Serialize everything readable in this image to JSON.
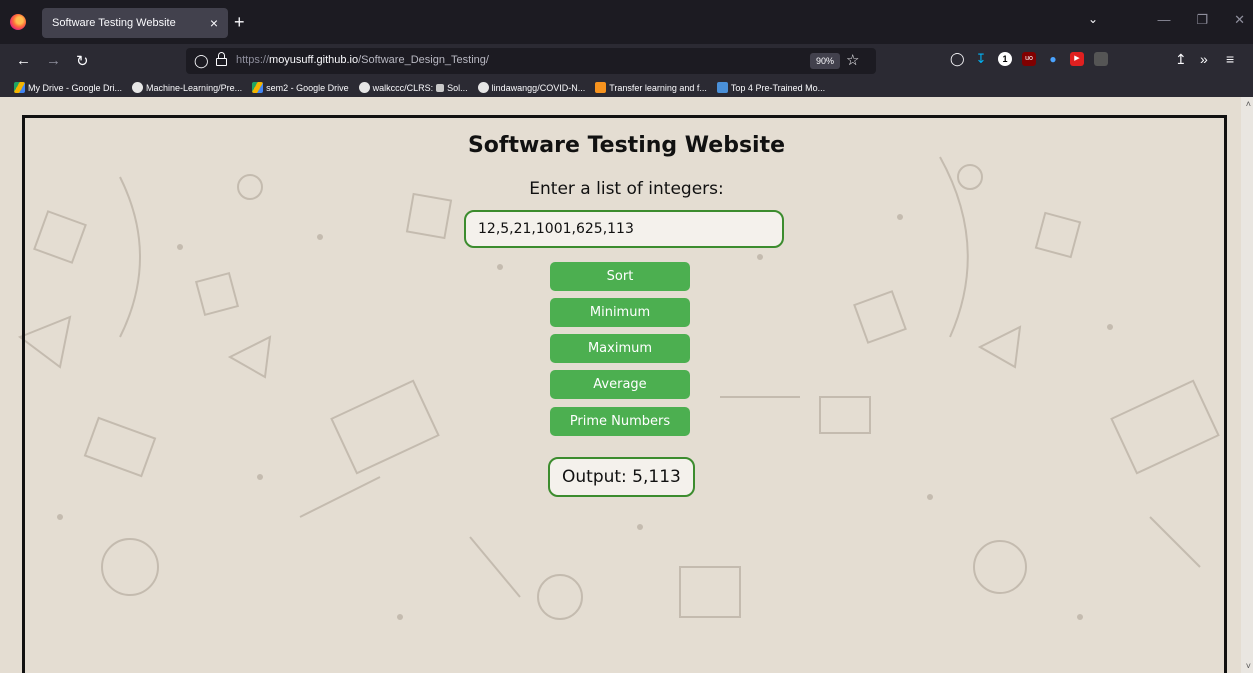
{
  "browser": {
    "tab_title": "Software Testing Website",
    "tab_close": "×",
    "new_tab": "+",
    "url_protocol": "https://",
    "url_host": "moyusuff.github.io",
    "url_path": "/Software_Design_Testing/",
    "zoom": "90%",
    "bookmarks": [
      {
        "label": "My Drive - Google Dri...",
        "color": "#1fa463"
      },
      {
        "label": "Machine-Learning/Pre...",
        "color": "#e6e6e6"
      },
      {
        "label": "sem2 - Google Drive",
        "color": "#f4b400"
      },
      {
        "label": "walkccc/CLRS: ",
        "color": "#e6e6e6"
      },
      {
        "label": "Sol...",
        "color": "#c9c9c9"
      },
      {
        "label": "lindawangg/COVID-N...",
        "color": "#e6e6e6"
      },
      {
        "label": "Transfer learning and f...",
        "color": "#f7931e"
      },
      {
        "label": "Top 4 Pre-Trained Mo...",
        "color": "#4a90d9"
      }
    ]
  },
  "page": {
    "title": "Software Testing Website",
    "prompt": "Enter a list of integers:",
    "input_value": "12,5,21,1001,625,113",
    "buttons": {
      "sort": "Sort",
      "minimum": "Minimum",
      "maximum": "Maximum",
      "average": "Average",
      "prime": "Prime Numbers"
    },
    "output": "Output: 5,113",
    "accent_color": "#4caf50",
    "border_color": "#3c8c2e"
  }
}
